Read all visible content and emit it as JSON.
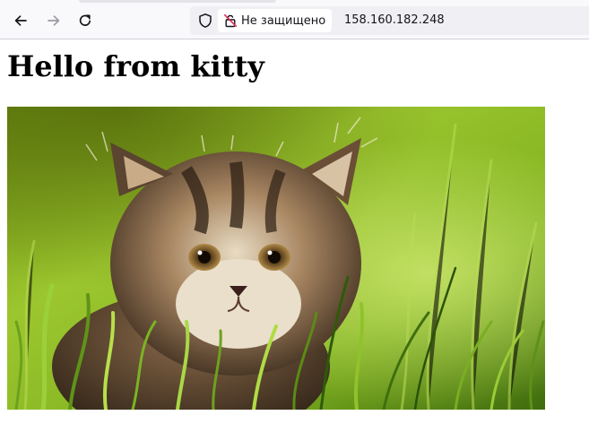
{
  "browser": {
    "security_label": "Не защищено",
    "url": "158.160.182.248",
    "icons": {
      "back": "back-arrow-icon",
      "forward": "forward-arrow-icon",
      "reload": "reload-icon",
      "tracking": "shield-icon",
      "insecure": "insecure-lock-icon"
    }
  },
  "page": {
    "heading": "Hello from kitty",
    "image": {
      "alt": "kitten in grass"
    }
  },
  "colors": {
    "grass_light": "#a6cf3a",
    "grass_dark": "#3f6b0e",
    "fur": "#8a6a4a",
    "insecure_red": "#e22850"
  }
}
